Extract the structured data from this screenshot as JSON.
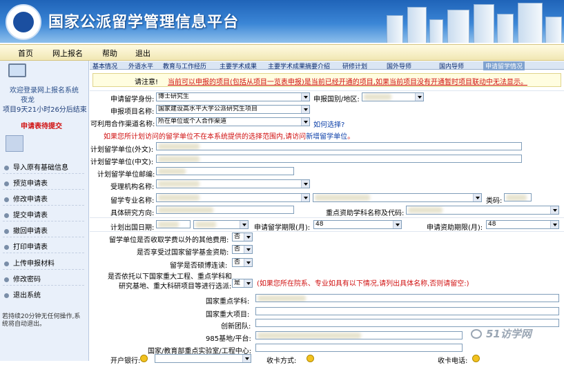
{
  "header": {
    "title": "国家公派留学管理信息平台"
  },
  "nav": {
    "items": [
      "首页",
      "网上报名",
      "帮助",
      "退出"
    ]
  },
  "sidebar": {
    "welcome": "欢迎登录网上报名系统",
    "user": "夜龙",
    "countdown": "项目9天21小时26分后结束",
    "status": "申请表待提交",
    "menu": [
      "导入原有基础信息",
      "预览申请表",
      "修改申请表",
      "提交申请表",
      "撤回申请表",
      "打印申请表",
      "上传申报材料",
      "修改密码",
      "退出系统"
    ],
    "timeout_note": "若持续20分钟无任何操作,系统将自动退出。"
  },
  "tabs": [
    "基本情况",
    "外语水平",
    "教育与工作经历",
    "主要学术成果",
    "主要学术成果摘要介绍",
    "研修计划",
    "国外导师",
    "国内导师",
    "申请留学情况"
  ],
  "notice": {
    "prefix": "请注意!",
    "text": "当前可以申报的项目(包括从项目一览表申报)是当前已经开通的项目,如果当前项目没有开通暂时项目联动中无法显示。"
  },
  "form": {
    "identity_label": "申请留学身份:",
    "identity_value": "博士研究生",
    "country_label": "申报国别/地区:",
    "project_label": "申报项目名称:",
    "project_value": "国家建设高水平大学公派研究生项目",
    "channel_label": "可利用合作渠道名称:",
    "channel_value": "所在单位或个人合作渠道",
    "how_link": "如何选择?",
    "hint_prefix": "如果您所计划访问的留学单位不在本系统提供的选择范围内,请访问",
    "hint_link": "新增留学单位",
    "hint_suffix": "。",
    "unit_foreign_label": "计划留学单位(外文):",
    "unit_cn_label": "计划留学单位(中文):",
    "unit_email_label": "计划留学单位邮编:",
    "org_label": "受理机构名称:",
    "major_label": "留学专业名称:",
    "category_label": "类码:",
    "direction_label": "具体研究方向:",
    "key_subject_label": "重点资助学科名称及代码:",
    "depart_label": "计划出国日期:",
    "study_period_label": "申请留学期限(月):",
    "study_period_value": "48",
    "fund_period_label": "申请资助期限(月):",
    "fund_period_value": "48",
    "fee_label": "留学单位是否收取学费以外的其他费用:",
    "fee_value": "否",
    "other_fund_label": "是否享受过国家留学基金资助:",
    "other_fund_value": "否",
    "phd_label": "留学是否硕博连读:",
    "phd_value": "否",
    "rely_label_1": "是否依托以下国家重大工程、重点学科和",
    "rely_label_2": "研究基地、重大科研项目等进行选派:",
    "rely_value": "是",
    "rely_hint": "(如果您所在院系、专业如具有以下情况,请列出具体名称,否则请留空:)",
    "key_discipline_label": "国家重点学科:",
    "major_project_label": "国家重大项目:",
    "innovation_label": "创新团队:",
    "base_label": "985基地/平台:",
    "lab_label": "国家/教育部重点实验室/工程中心:",
    "bank_label": "开户银行:",
    "card_type_label": "收卡方式:",
    "card_phone_label": "收卡电话:"
  },
  "watermark": "51访学网"
}
